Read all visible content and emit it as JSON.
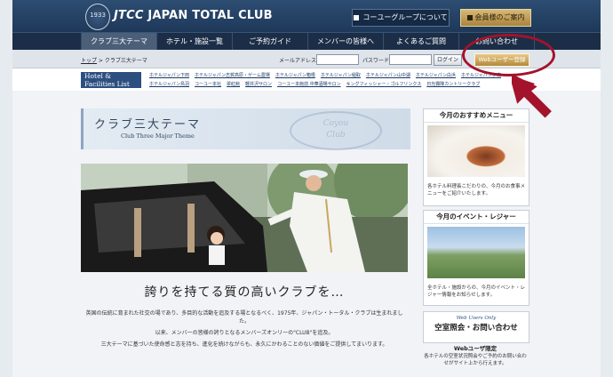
{
  "header": {
    "crest_text": "1933",
    "logo_prefix": "JTCC",
    "logo_main": "JAPAN TOTAL CLUB",
    "group_button": "コーユーグループについて",
    "member_button": "会員様のご案内"
  },
  "nav": {
    "items": [
      "クラブ三大テーマ",
      "ホテル・施設一覧",
      "ご予約ガイド",
      "メンバーの皆様へ",
      "よくあるご質問",
      "お問い合わせ"
    ]
  },
  "subbar": {
    "breadcrumb_home": "トップ",
    "breadcrumb_sep": " > ",
    "breadcrumb_current": "クラブ三大テーマ",
    "mail_label": "メールアドレス",
    "password_label": "パスワード",
    "login_button": "ログイン",
    "web_register": "Webユーザー登録"
  },
  "hotels": {
    "badge_line1": "Hotel &",
    "badge_line2": "Facilities List",
    "links": [
      "ホテルジャパン下田",
      "ホテルジャパン志賀高原・ゲーム農場",
      "ホテルジャパン箱根",
      "ホテルジャパン稲取",
      "ホテルジャパン山中湖",
      "ホテルジャパン白浜",
      "ホテルジャパン伊東",
      "ホテルジャパン鳥羽",
      "コーユー本社",
      "翠紅館",
      "軽井沢サロン",
      "コーユー本館前 中華酒場サロン",
      "キングフィッシャー・ゴルフリンクス",
      "日光霧降カントリークラブ"
    ]
  },
  "main": {
    "title_jp": "クラブ三大テーマ",
    "title_en": "Club Three Major Theme",
    "seal_line1": "Coyou",
    "seal_line2": "Club",
    "headline": "誇りを持てる質の高いクラブを…",
    "para1": "英国の伝統に育まれた社交の場であり、多目的な活動を追及する場となるべく、1975年、ジャパン・トータル・クラブは生まれました。",
    "para2": "以来、メンバーの皆様の誇りとなるメンバーズオンリーの\"CLUB\"を追及。",
    "para3": "三大テーマに基づいた使命感と志を持ち、進化を続けながらも、永久にかわることのない価値をご提供してまいります。"
  },
  "sidebar": {
    "menu_title": "今月のおすすめメニュー",
    "menu_caption": "各ホテル料理長こだわりの、今月のお食事メニューをご紹介いたします。",
    "event_title": "今月のイベント・レジャー",
    "event_caption": "全ホテル・施設からの、今月のイベント・レジャー情報をお知らせします。",
    "contact_en": "Web Users Only",
    "contact_jp": "空室照会・お問い合わせ",
    "webonly_title": "Webユーザ限定",
    "webonly_caption": "各ホテルの空室状況照会やご予約のお問い合わせがサイト上から行えます。"
  },
  "colors": {
    "header_navy": "#1e3859",
    "gold": "#c9a65e",
    "annotation_red": "#a3132c"
  }
}
